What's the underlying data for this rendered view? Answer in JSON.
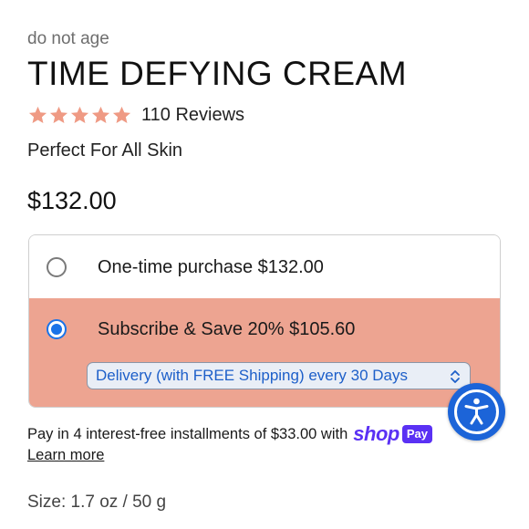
{
  "product": {
    "brand": "do not age",
    "title": "TIME DEFYING CREAM",
    "rating": {
      "stars": 5,
      "reviews_label": "110 Reviews",
      "star_color": "#ef9a84"
    },
    "subtitle": "Perfect For All Skin",
    "price": "$132.00",
    "size_label": "Size: 1.7 oz / 50 g"
  },
  "purchase_options": {
    "one_time": {
      "label": "One-time purchase $132.00",
      "selected": false
    },
    "subscribe": {
      "label": "Subscribe & Save 20% $105.60",
      "selected": true,
      "delivery_select": "Delivery (with FREE Shipping) every 30 Days",
      "highlight_color": "#eda491"
    }
  },
  "payment": {
    "installments_text": "Pay in 4 interest-free installments of $33.00 with",
    "shop_logo_word": "shop",
    "shop_logo_badge": "Pay",
    "learn_more": "Learn more"
  },
  "accessibility_button": {
    "icon": "accessibility-icon",
    "color": "#1c64d8"
  }
}
